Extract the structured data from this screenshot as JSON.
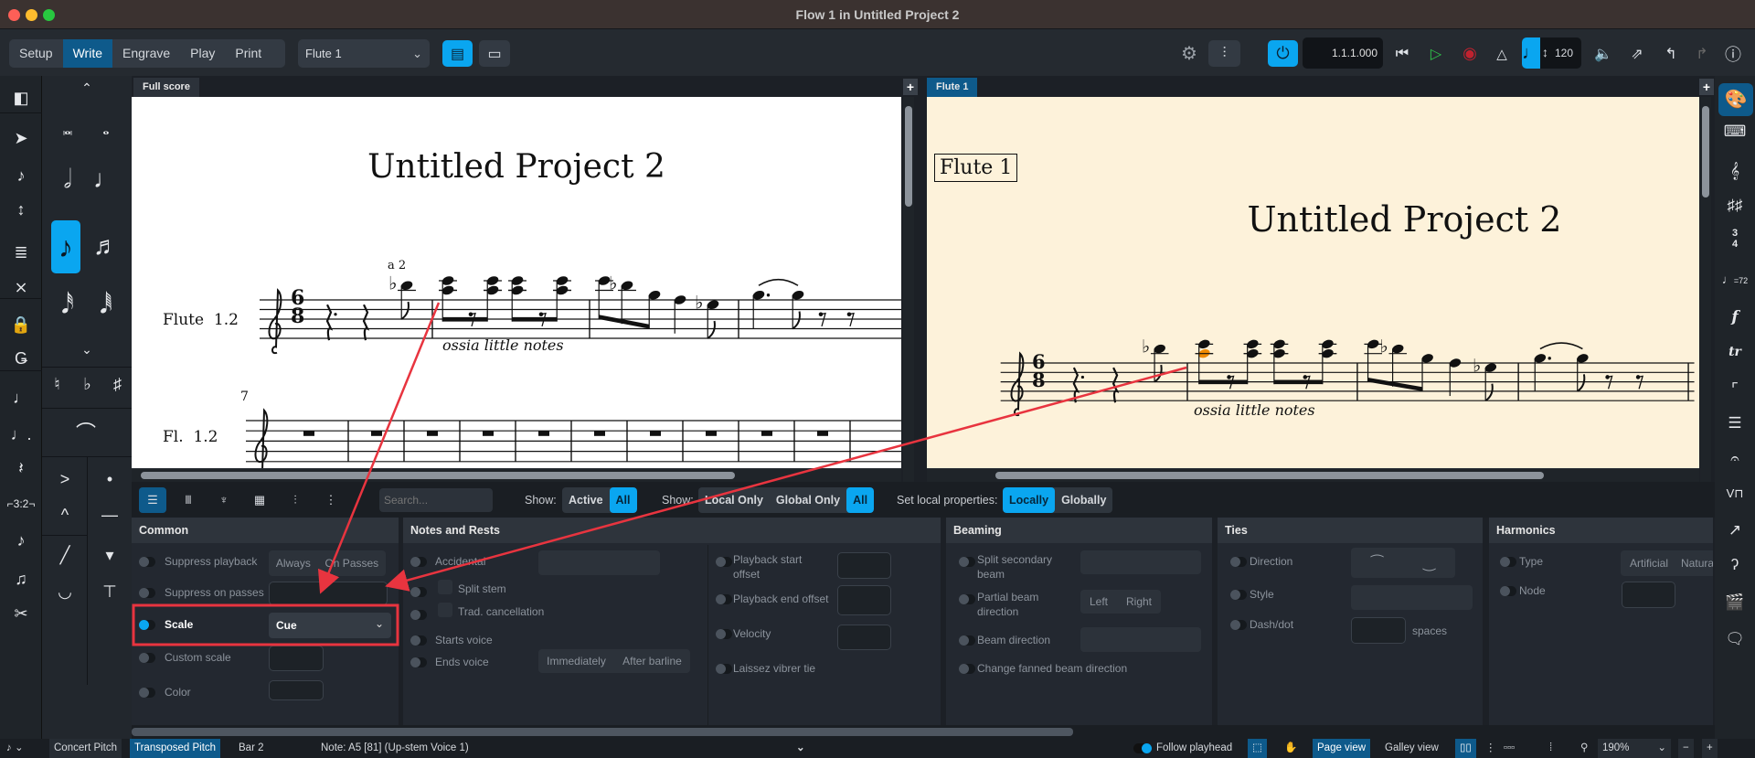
{
  "window": {
    "title": "Flow 1 in Untitled Project 2"
  },
  "toolbar": {
    "modes": [
      "Setup",
      "Write",
      "Engrave",
      "Play",
      "Print"
    ],
    "active_mode": "Write",
    "layout_select": "Flute 1",
    "position": "1.1.1.000",
    "tempo": "120"
  },
  "tabs": {
    "left": "Full score",
    "right": "Flute 1"
  },
  "score_left": {
    "title": "Untitled Project 2",
    "instrument": "Flute  1.2",
    "a2": "a 2",
    "ossia": "ossia little notes",
    "bar_number": "7",
    "instrument_short": "Fl.  1.2",
    "time_sig_top": "6",
    "time_sig_bottom": "8"
  },
  "score_right": {
    "part_name": "Flute 1",
    "title": "Untitled Project 2",
    "ossia": "ossia little notes",
    "time_sig_top": "6",
    "time_sig_bottom": "8"
  },
  "properties_toolbar": {
    "search_placeholder": "Search...",
    "show_label": "Show:",
    "show_options": [
      "Active",
      "All"
    ],
    "show2_label": "Show:",
    "show2_options": [
      "Local Only",
      "Global Only",
      "All"
    ],
    "set_local_label": "Set local properties:",
    "set_local_options": [
      "Locally",
      "Globally"
    ]
  },
  "panels": {
    "common": {
      "title": "Common",
      "suppress_playback": "Suppress playback",
      "suppress_options": [
        "Always",
        "On Passes"
      ],
      "suppress_on_passes": "Suppress on passes",
      "scale": "Scale",
      "scale_value": "Cue",
      "custom_scale": "Custom scale",
      "color": "Color"
    },
    "notes_rests": {
      "title": "Notes and Rests",
      "accidental": "Accidental",
      "split_stem": "Split stem",
      "trad_cancellation": "Trad. cancellation",
      "starts_voice": "Starts voice",
      "ends_voice": "Ends voice",
      "ends_options": [
        "Immediately",
        "After barline"
      ],
      "playback_start_offset_1": "Playback start",
      "playback_start_offset_2": "offset",
      "playback_end_offset": "Playback end offset",
      "velocity": "Velocity",
      "laissez_vibrer": "Laissez vibrer tie"
    },
    "beaming": {
      "title": "Beaming",
      "split_secondary_1": "Split secondary",
      "split_secondary_2": "beam",
      "partial_beam_1": "Partial beam",
      "partial_beam_2": "direction",
      "partial_options": [
        "Left",
        "Right"
      ],
      "beam_direction": "Beam direction",
      "fanned": "Change fanned beam direction"
    },
    "ties": {
      "title": "Ties",
      "direction": "Direction",
      "style": "Style",
      "dash_dot": "Dash/dot",
      "spaces": "spaces"
    },
    "harmonics": {
      "title": "Harmonics",
      "type": "Type",
      "type_options": [
        "Artificial",
        "Natural"
      ],
      "node": "Node"
    }
  },
  "status_bar": {
    "concert_pitch": "Concert Pitch",
    "transposed_pitch": "Transposed Pitch",
    "bar": "Bar 2",
    "note_info": "Note: A5 [81] (Up-stem Voice 1)",
    "follow_playhead": "Follow playhead",
    "page_view": "Page view",
    "galley_view": "Galley view",
    "zoom": "190%"
  },
  "right_panel": {
    "metronome_mark": "=72"
  },
  "colors": {
    "accent": "#0aa6f0",
    "active_mode": "#0e5a8b",
    "annotation": "#e8343f",
    "selected_note": "#f08a00",
    "part_paper": "#fdf2da"
  }
}
